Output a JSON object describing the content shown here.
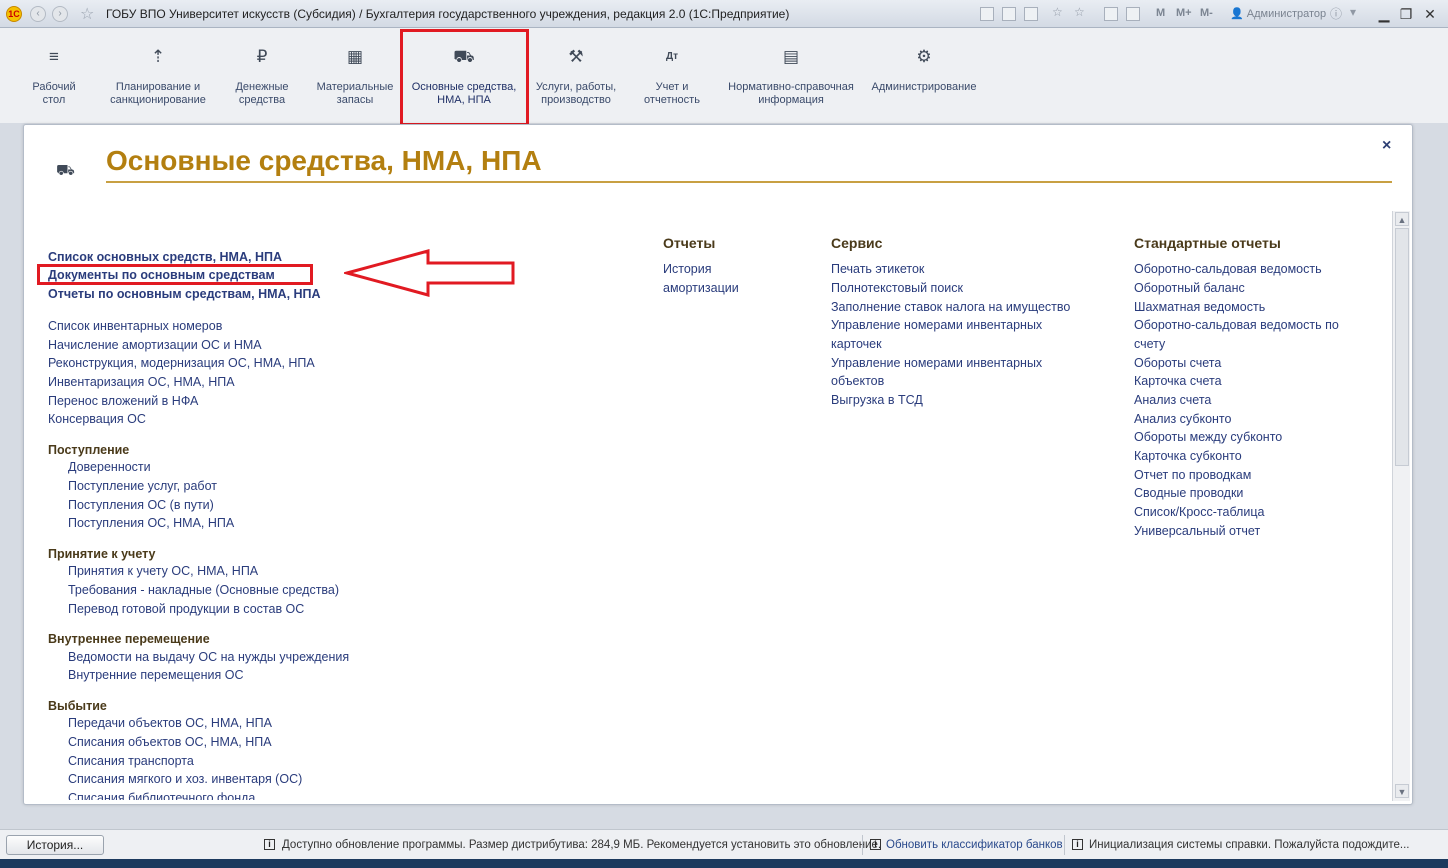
{
  "window": {
    "title": "ГОБУ ВПО Университет искусств (Субсидия) / Бухгалтерия государственного учреждения, редакция 2.0  (1С:Предприятие)",
    "logo_text": "1С",
    "m_buttons": [
      "M",
      "M+",
      "M-"
    ],
    "user": "Администратор"
  },
  "sections": [
    {
      "icon": "≡",
      "label1": "Рабочий",
      "label2": "стол"
    },
    {
      "icon": "⇡",
      "label1": "Планирование и",
      "label2": "санкционирование"
    },
    {
      "icon": "₽",
      "label1": "Денежные",
      "label2": "средства"
    },
    {
      "icon": "▦",
      "label1": "Материальные",
      "label2": "запасы"
    },
    {
      "icon": "⛟",
      "label1": "Основные средства,",
      "label2": "НМА, НПА"
    },
    {
      "icon": "⚒",
      "label1": "Услуги, работы,",
      "label2": "производство"
    },
    {
      "icon": "Дт",
      "label1": "Учет и",
      "label2": "отчетность"
    },
    {
      "icon": "▤",
      "label1": "Нормативно-справочная",
      "label2": "информация"
    },
    {
      "icon": "⚙",
      "label1": "Администрирование",
      "label2": ""
    }
  ],
  "panel": {
    "title": "Основные средства, НМА, НПА",
    "close": "×",
    "main_links": [
      "Список основных средств, НМА, НПА",
      "Документы по основным средствам",
      "Отчеты по основным средствам, НМА, НПА"
    ],
    "links": [
      "Список инвентарных номеров",
      "Начисление амортизации ОС и НМА",
      "Реконструкция, модернизация ОС, НМА, НПА",
      "Инвентаризация ОС, НМА, НПА",
      "Перенос вложений в НФА",
      "Консервация ОС"
    ],
    "groups": [
      {
        "title": "Поступление",
        "items": [
          "Доверенности",
          "Поступление услуг, работ",
          "Поступления ОС (в пути)",
          "Поступления ОС, НМА, НПА"
        ]
      },
      {
        "title": "Принятие к учету",
        "items": [
          "Принятия к учету ОС, НМА, НПА",
          "Требования - накладные (Основные средства)",
          "Перевод готовой продукции в состав ОС"
        ]
      },
      {
        "title": "Внутреннее перемещение",
        "items": [
          "Ведомости на выдачу ОС на нужды учреждения",
          "Внутренние перемещения ОС"
        ]
      },
      {
        "title": "Выбытие",
        "items": [
          "Передачи объектов ОС, НМА, НПА",
          "Списания объектов ОС, НМА, НПА",
          "Списания транспорта",
          "Списания мягкого и хоз. инвентаря (ОС)",
          "Списания библиотечного фонда"
        ]
      }
    ],
    "reports": {
      "title": "Отчеты",
      "items": [
        "История",
        "амортизации"
      ]
    },
    "service": {
      "title": "Сервис",
      "items": [
        "Печать этикеток",
        "Полнотекстовый поиск",
        "Заполнение ставок налога на имущество",
        "Управление номерами инвентарных",
        "карточек",
        "Управление номерами инвентарных",
        "объектов",
        "Выгрузка в ТСД"
      ]
    },
    "standard": {
      "title": "Стандартные отчеты",
      "items": [
        "Оборотно-сальдовая ведомость",
        "Оборотный баланс",
        "Шахматная ведомость",
        "Оборотно-сальдовая ведомость по",
        "счету",
        "Обороты счета",
        "Карточка счета",
        "Анализ счета",
        "Анализ субконто",
        "Обороты между субконто",
        "Карточка субконто",
        "Отчет по проводкам",
        "Сводные проводки",
        "Список/Кросс-таблица",
        "Универсальный отчет"
      ]
    }
  },
  "statusbar": {
    "history_button": "История...",
    "msg1": "Доступно обновление программы. Размер дистрибутива: 284,9 МБ. Рекомендуется установить это обновление.",
    "msg2": "Обновить классификатор банков",
    "msg3": "Инициализация системы справки. Пожалуйста подождите..."
  },
  "colors": {
    "title_gold": "#b37f10",
    "link_blue": "#2a3c7c",
    "highlight_red": "#e11a22"
  }
}
